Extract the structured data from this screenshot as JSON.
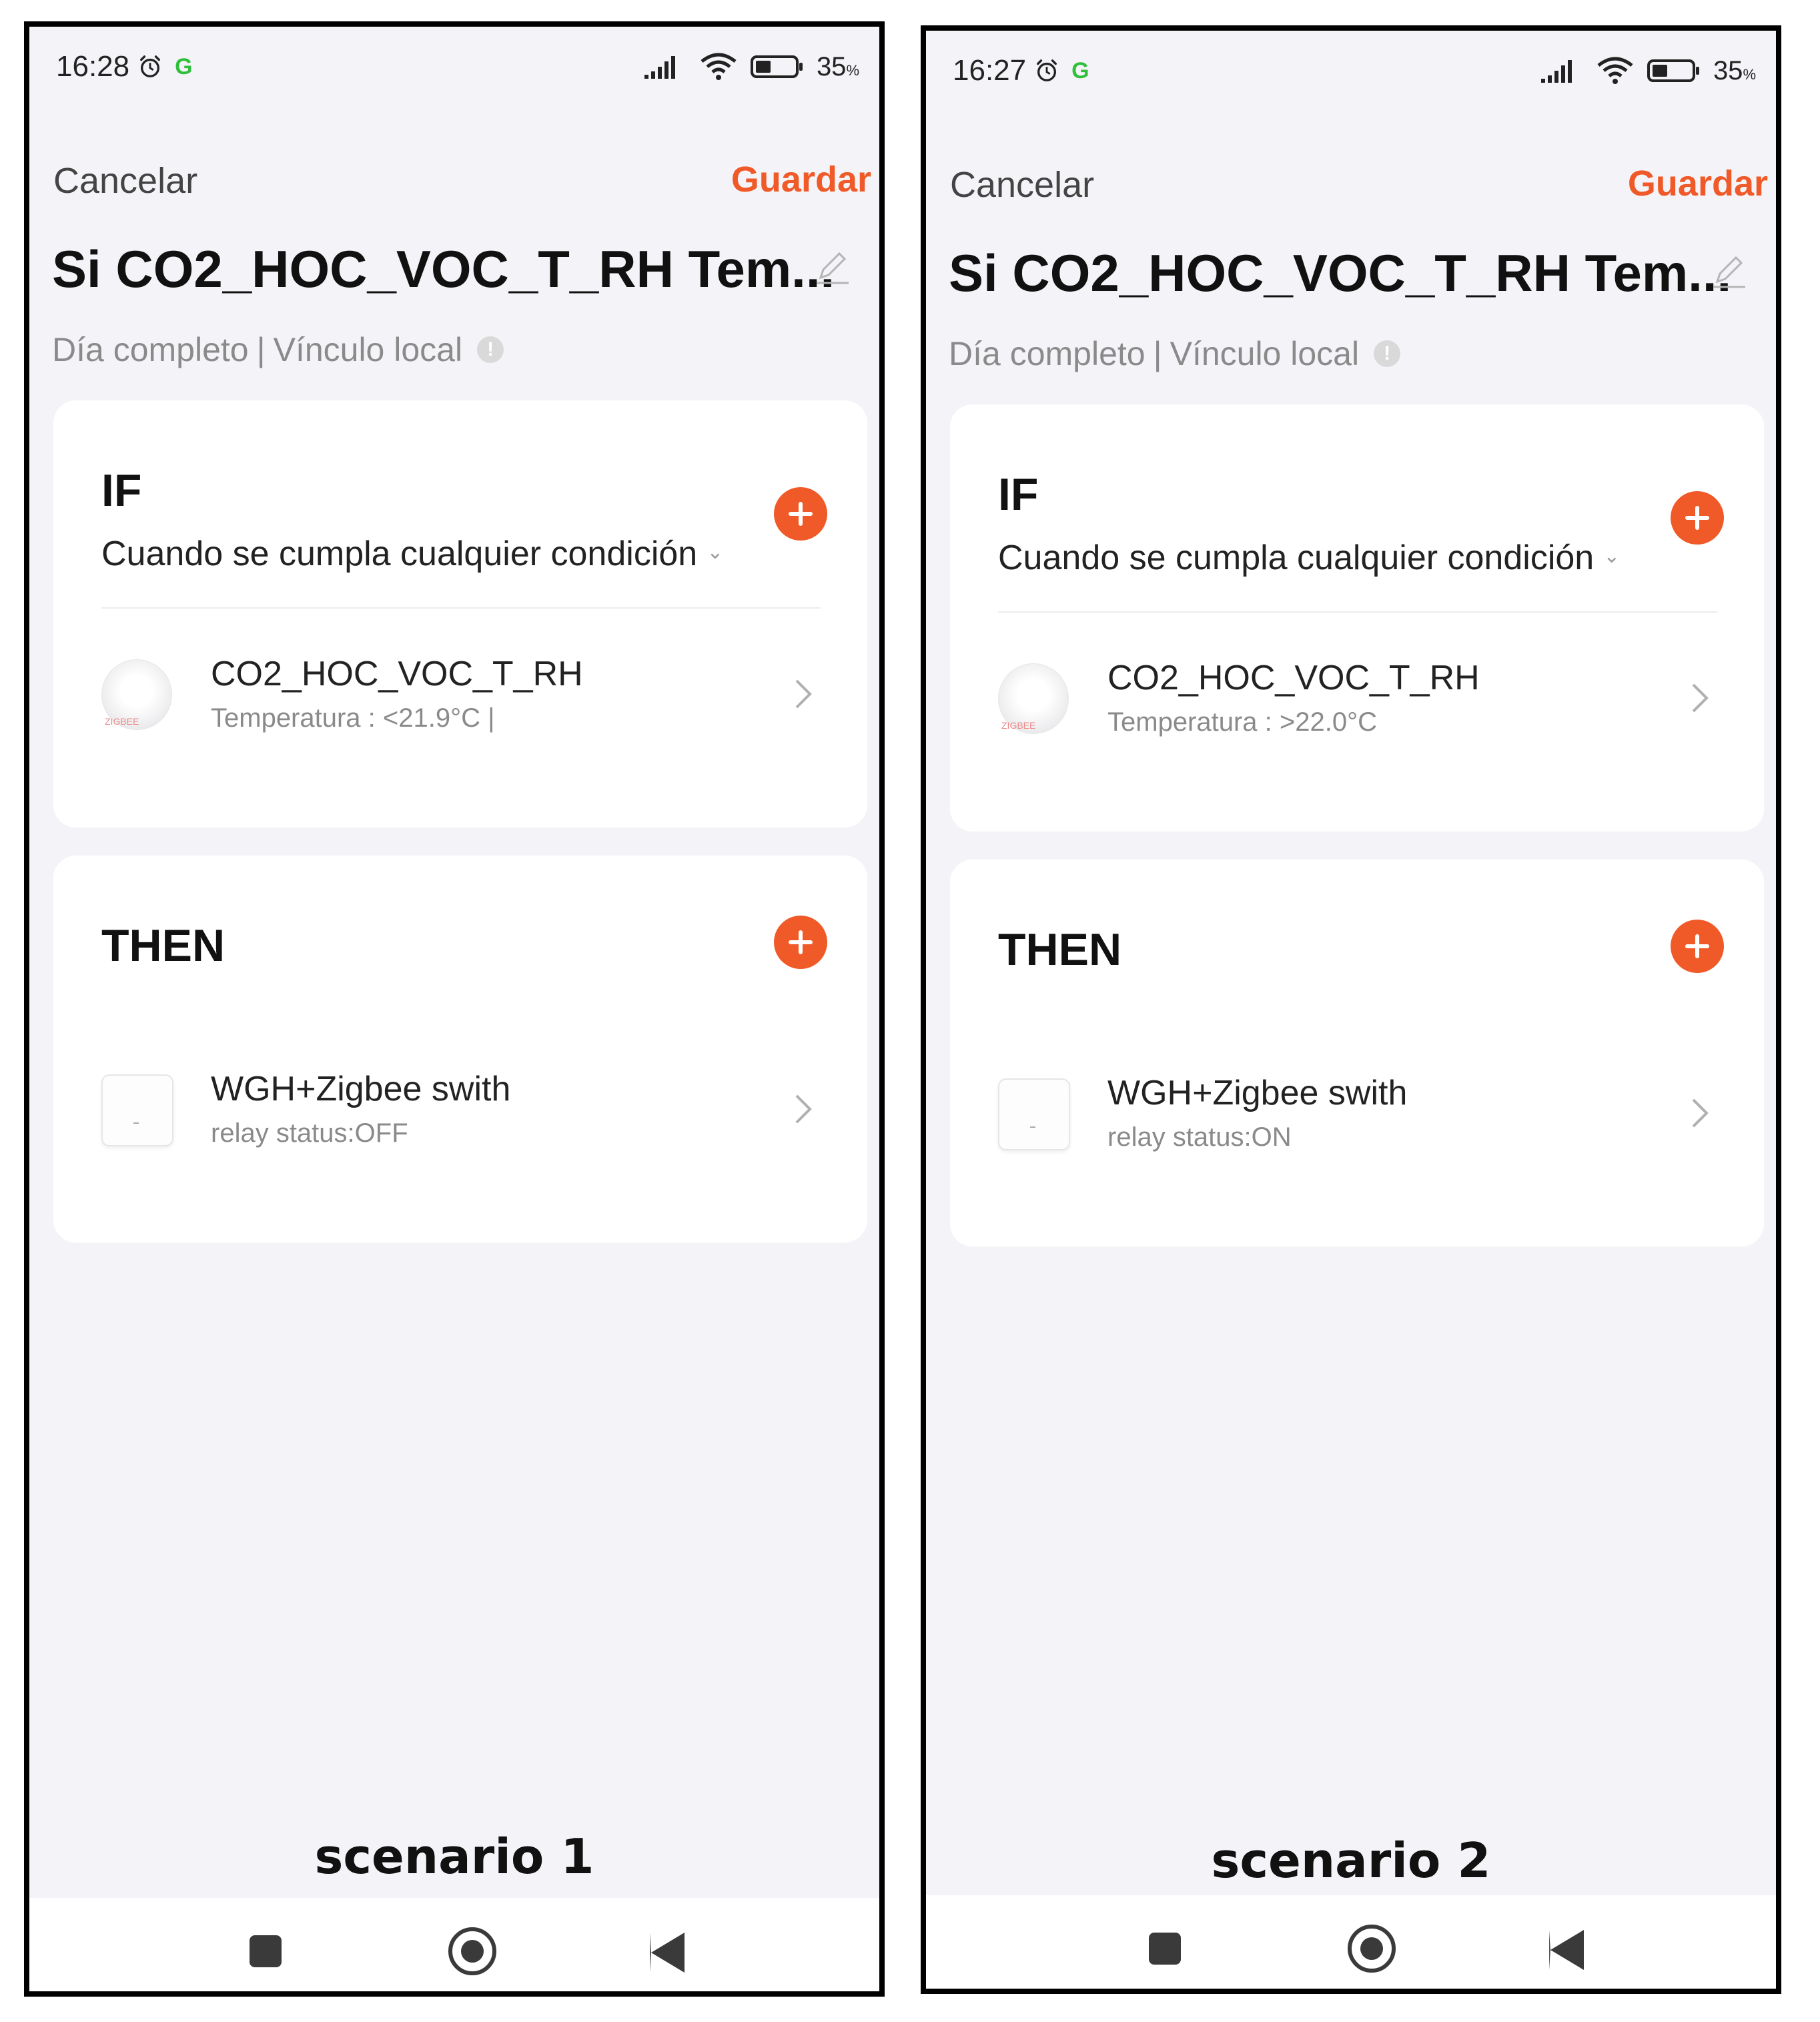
{
  "colors": {
    "accent": "#f05a28",
    "status_dot": "#2fbf3a",
    "muted_text": "#8a8a8a",
    "frame": "#000000"
  },
  "screens": [
    {
      "status": {
        "time": "16:28",
        "battery": "35",
        "battery_unit": "%"
      },
      "header": {
        "cancel_label": "Cancelar",
        "save_label": "Guardar"
      },
      "title": "Si CO2_HOC_VOC_T_RH Tem...",
      "subtitle": {
        "schedule": "Día completo",
        "separator": "|",
        "link": "Vínculo local"
      },
      "if": {
        "heading": "IF",
        "mode": "Cuando se cumpla cualquier condición",
        "condition": {
          "device_name": "CO2_HOC_VOC_T_RH",
          "detail": "Temperatura : <21.9°C |",
          "image_brand": "ZIGBEE"
        }
      },
      "then": {
        "heading": "THEN",
        "action": {
          "device_name": "WGH+Zigbee swith",
          "detail": "relay status:OFF"
        }
      },
      "caption": "scenario 1"
    },
    {
      "status": {
        "time": "16:27",
        "battery": "35",
        "battery_unit": "%"
      },
      "header": {
        "cancel_label": "Cancelar",
        "save_label": "Guardar"
      },
      "title": "Si CO2_HOC_VOC_T_RH Tem...",
      "subtitle": {
        "schedule": "Día completo",
        "separator": "|",
        "link": "Vínculo local"
      },
      "if": {
        "heading": "IF",
        "mode": "Cuando se cumpla cualquier condición",
        "condition": {
          "device_name": "CO2_HOC_VOC_T_RH",
          "detail": "Temperatura : >22.0°C",
          "image_brand": "ZIGBEE"
        }
      },
      "then": {
        "heading": "THEN",
        "action": {
          "device_name": "WGH+Zigbee swith",
          "detail": "relay status:ON"
        }
      },
      "caption": "scenario 2"
    }
  ],
  "icons": {
    "status": [
      "alarm-icon",
      "g-icon",
      "signal-icon",
      "wifi-icon",
      "battery-icon"
    ],
    "title": "edit-icon",
    "subtitle": "info-icon",
    "cards": [
      "add-icon",
      "chevron-right-icon",
      "chevron-down-icon"
    ],
    "navbar": [
      "recent-apps-icon",
      "home-icon",
      "back-icon"
    ]
  }
}
